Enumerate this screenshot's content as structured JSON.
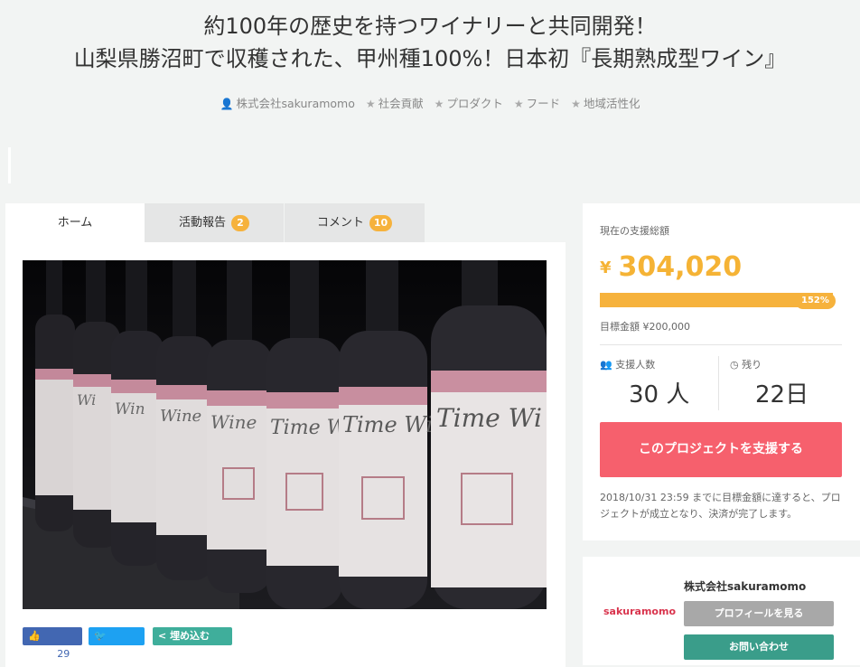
{
  "header": {
    "title_line1": "約100年の歴史を持つワイナリーと共同開発！",
    "title_line2": "山梨県勝沼町で収穫された、甲州種100%！日本初『長期熟成型ワイン』",
    "owner": "株式会社sakuramomo",
    "tags": [
      "社会貢献",
      "プロダクト",
      "フード",
      "地域活性化"
    ]
  },
  "tabs": [
    {
      "label": "ホーム"
    },
    {
      "label": "活動報告",
      "badge": "2"
    },
    {
      "label": "コメント",
      "badge": "10"
    }
  ],
  "hero": {
    "bottle_label_text": "Time Wine"
  },
  "share": {
    "fb_label": "Like",
    "fb_count": "29",
    "tweet_label": "Tweet",
    "embed_label": "埋め込む"
  },
  "stats": {
    "current_label": "現在の支援総額",
    "currency": "¥",
    "amount": "304,020",
    "progress_percent_label": "152%",
    "progress_fraction": 1.0,
    "goal_label": "目標金額 ¥200,000",
    "supporters_label": "支援人数",
    "supporters_value": "30 人",
    "remaining_label": "残り",
    "remaining_value": "22日",
    "support_button": "このプロジェクトを支援する",
    "notice": "2018/10/31 23:59 までに目標金額に達すると、プロジェクトが成立となり、決済が完了します。"
  },
  "owner": {
    "logo_text": "sakuramomo",
    "name": "株式会社sakuramomo",
    "profile_button": "プロフィールを見る",
    "contact_button": "お問い合わせ"
  },
  "colors": {
    "accent": "#f6b23c",
    "support_button": "#f6606d",
    "contact_button": "#3a9d8a"
  }
}
